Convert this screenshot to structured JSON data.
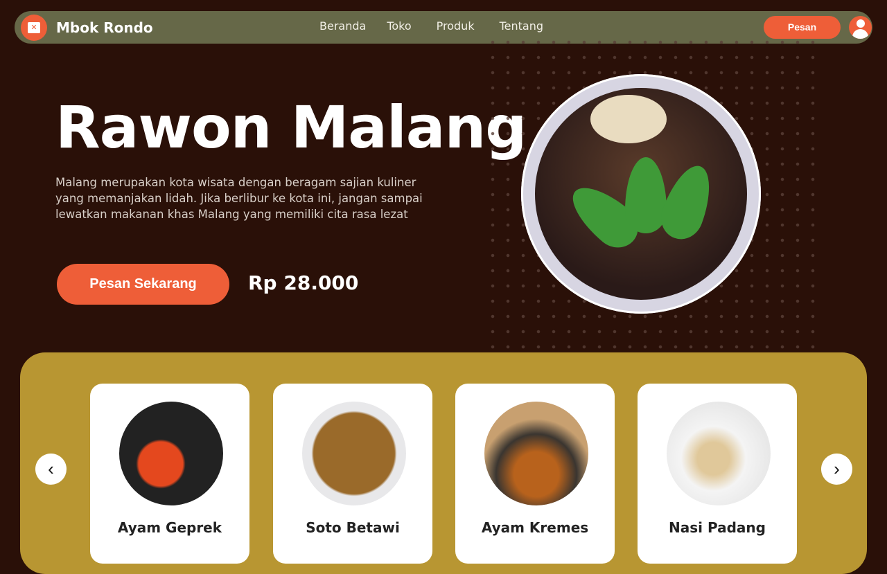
{
  "nav": {
    "brand": "Mbok Rondo",
    "links": [
      "Beranda",
      "Toko",
      "Produk",
      "Tentang"
    ],
    "order_label": "Pesan",
    "logo_icon": "shopping-bag-utensils-icon",
    "avatar_icon": "user-icon"
  },
  "hero": {
    "title": "Rawon Malang",
    "description": "Malang merupakan kota wisata dengan beragam sajian kuliner yang memanjakan lidah. Jika berlibur ke kota ini, jangan sampai lewatkan makanan khas Malang yang memiliki cita rasa lezat",
    "cta": "Pesan Sekarang",
    "price": "Rp 28.000"
  },
  "products": [
    {
      "name": "Ayam Geprek"
    },
    {
      "name": "Soto Betawi"
    },
    {
      "name": "Ayam Kremes"
    },
    {
      "name": "Nasi Padang"
    }
  ],
  "carousel": {
    "prev": "‹",
    "next": "›"
  },
  "colors": {
    "background": "#2a1008",
    "nav": "#666848",
    "accent": "#ee5e38",
    "panel": "#b89632"
  }
}
